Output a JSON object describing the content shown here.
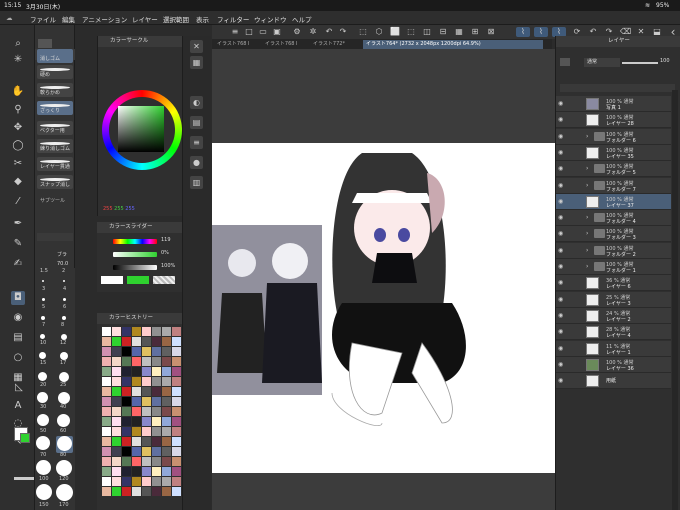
{
  "status": {
    "time": "15:15",
    "date": "3月30日(木)",
    "battery": "95%"
  },
  "menu": [
    "ファイル",
    "編集",
    "アニメーション",
    "レイヤー",
    "選択範囲",
    "表示",
    "フィルター",
    "ウィンドウ",
    "ヘルプ"
  ],
  "tabs": [
    "イラスト768 I",
    "イラスト768 I",
    "イラスト772*",
    "イラスト764* (2732 x 2048px 1200dpi 64.9%)"
  ],
  "subtool": {
    "header": "サブ",
    "brushes": [
      "消しゴム",
      "硬め",
      "軟らかめ",
      "ざっくり",
      "ベクター用",
      "練り消しゴム",
      "レイヤー貫通",
      "スナップ消し"
    ],
    "subtool_label": "サブツール",
    "size_value": "70.0",
    "size_label": "ブラ"
  },
  "brush_sizes": [
    "1.5",
    "2",
    "3",
    "4",
    "5",
    "6",
    "7",
    "8",
    "10",
    "12",
    "15",
    "17",
    "20",
    "25",
    "30",
    "40",
    "50",
    "60",
    "70",
    "80",
    "100",
    "120",
    "150",
    "170"
  ],
  "color_circle": {
    "title": "カラーサークル",
    "r": "255",
    "g": "255",
    "b": "255"
  },
  "color_slider": {
    "title": "カラースライダー",
    "v1": "119",
    "v2": "0%",
    "v3": "100%"
  },
  "color_history": {
    "title": "カラーヒストリー"
  },
  "layers": {
    "title": "レイヤー",
    "blend": "通常",
    "opacity": "100",
    "rows": [
      {
        "p": "100 % 通常",
        "n": "写真 1",
        "type": "img"
      },
      {
        "p": "100 % 通常",
        "n": "レイヤー 28",
        "type": "layer"
      },
      {
        "p": "100 % 通常",
        "n": "フォルダー 6",
        "type": "folder"
      },
      {
        "p": "100 % 通常",
        "n": "レイヤー 35",
        "type": "layer"
      },
      {
        "p": "100 % 通常",
        "n": "フォルダー 5",
        "type": "folder"
      },
      {
        "p": "100 % 通常",
        "n": "フォルダー 7",
        "type": "folder"
      },
      {
        "p": "100 % 通常",
        "n": "レイヤー 37",
        "type": "layer",
        "sel": true
      },
      {
        "p": "100 % 通常",
        "n": "フォルダー 4",
        "type": "folder"
      },
      {
        "p": "100 % 通常",
        "n": "フォルダー 3",
        "type": "folder"
      },
      {
        "p": "100 % 通常",
        "n": "フォルダー 2",
        "type": "folder"
      },
      {
        "p": "100 % 通常",
        "n": "フォルダー 1",
        "type": "folder"
      },
      {
        "p": "36 % 通常",
        "n": "レイヤー 6",
        "type": "layer"
      },
      {
        "p": "25 % 通常",
        "n": "レイヤー 3",
        "type": "layer"
      },
      {
        "p": "24 % 通常",
        "n": "レイヤー 2",
        "type": "layer"
      },
      {
        "p": "28 % 通常",
        "n": "レイヤー 4",
        "type": "layer"
      },
      {
        "p": "11 % 通常",
        "n": "レイヤー 1",
        "type": "layer"
      },
      {
        "p": "100 % 通常",
        "n": "レイヤー 36",
        "type": "green"
      },
      {
        "p": "",
        "n": "用紙",
        "type": "paper"
      }
    ]
  },
  "colors": {
    "accent": "#4a5f78",
    "main": "#ffffff",
    "sub": "#2fd22f"
  }
}
